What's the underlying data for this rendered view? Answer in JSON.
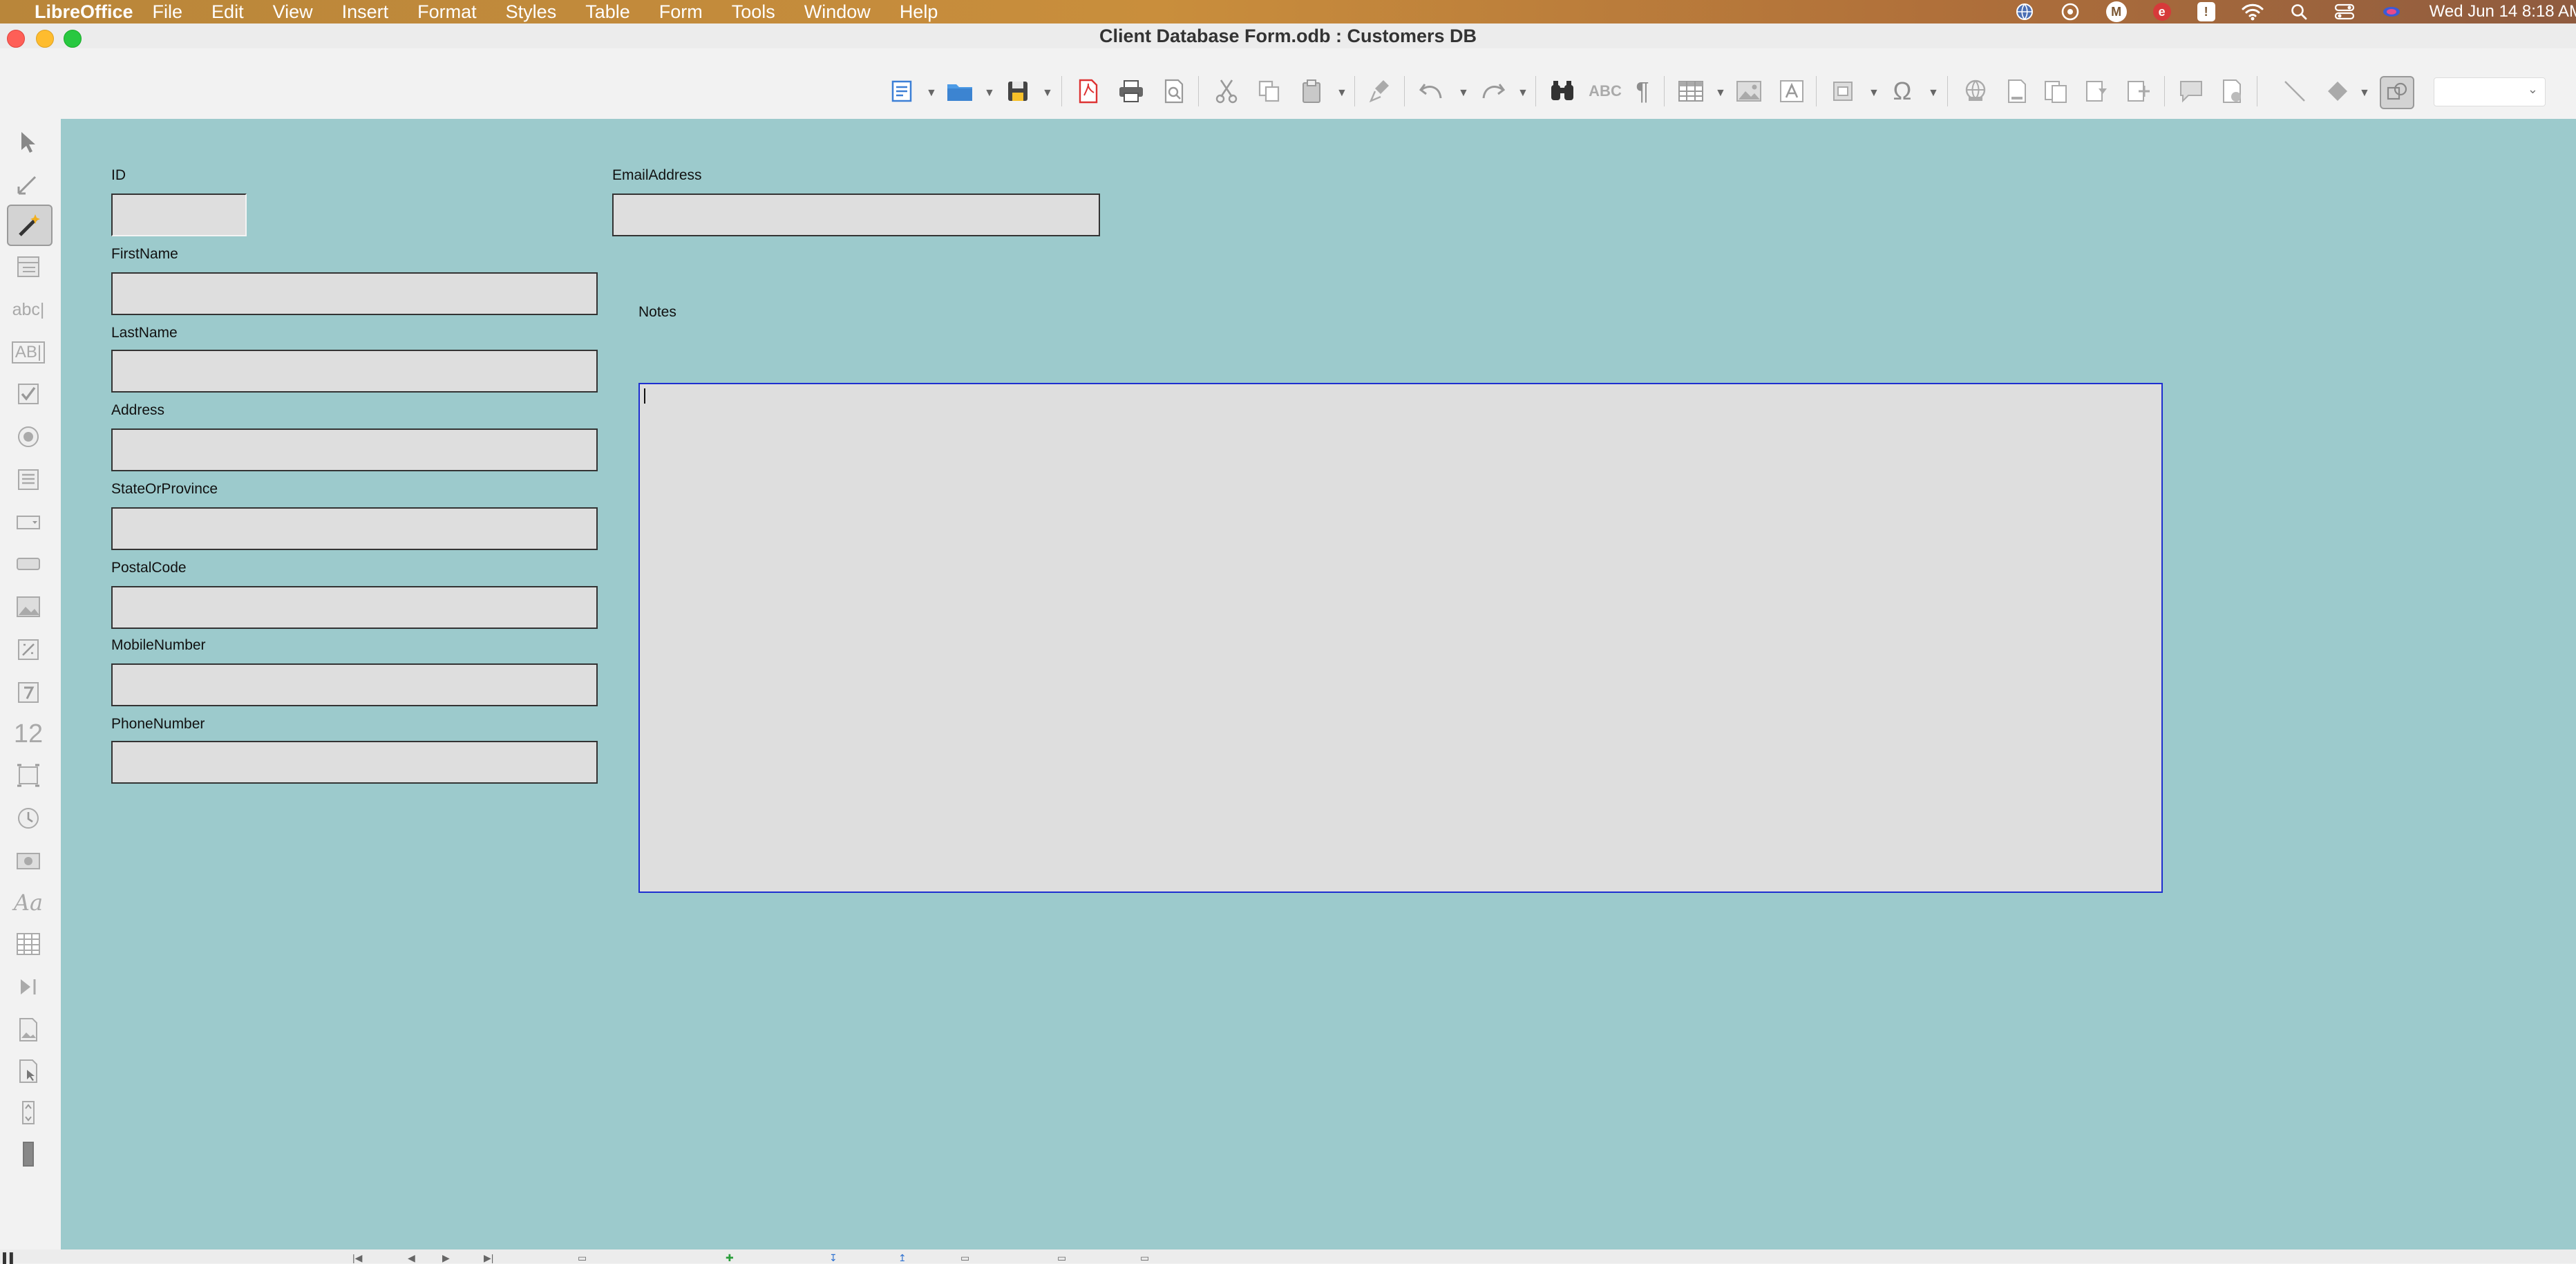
{
  "menubar": {
    "app_name": "LibreOffice",
    "menus": [
      "File",
      "Edit",
      "View",
      "Insert",
      "Format",
      "Styles",
      "Table",
      "Form",
      "Tools",
      "Window",
      "Help"
    ],
    "tray_m": "M",
    "tray_e": "e",
    "tray_alert": "!",
    "clock": "Wed Jun 14  8:18 AM"
  },
  "window": {
    "title": "Client Database Form.odb : Customers DB"
  },
  "form": {
    "id_label": "ID",
    "email_label": "EmailAddress",
    "firstname_label": "FirstName",
    "lastname_label": "LastName",
    "address_label": "Address",
    "state_label": "StateOrProvince",
    "postal_label": "PostalCode",
    "mobile_label": "MobileNumber",
    "phone_label": "PhoneNumber",
    "notes_label": "Notes"
  },
  "left_tools": {
    "text_box_label": "abc|",
    "formatted_label": "AB|",
    "numeric_label": "12",
    "font_label": "Aa"
  },
  "toolbar": {
    "spelling_label": "ABC"
  }
}
